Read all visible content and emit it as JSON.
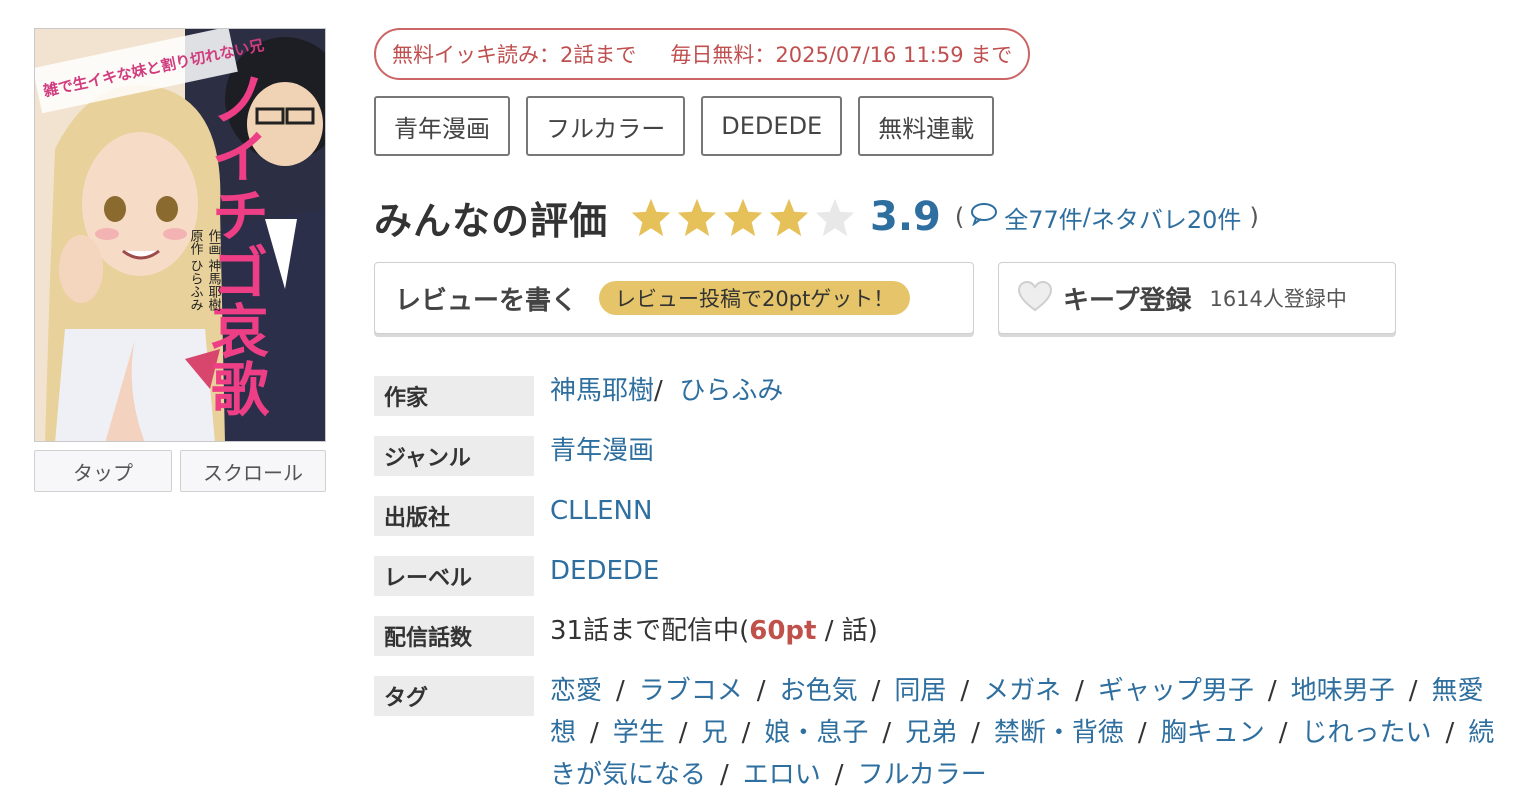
{
  "cover": {
    "title_main": "ノイチゴ哀歌",
    "tagline": "雑で生イキな妹と割り切れない兄",
    "credits": [
      "原作 ひらふみ",
      "作画 神馬耶樹"
    ]
  },
  "view_buttons": {
    "tap": "タップ",
    "scroll": "スクロール"
  },
  "free_badge": {
    "ikki": "無料イッキ読み：2話まで",
    "daily": "毎日無料：2025/07/16 11:59 まで"
  },
  "top_tags": [
    "青年漫画",
    "フルカラー",
    "DEDEDE",
    "無料連載"
  ],
  "rating": {
    "title": "みんなの評価",
    "score": "3.9",
    "stars_filled": 4,
    "stars_total": 5,
    "paren_open": "(",
    "paren_close": ")",
    "reviews_link": "全77件",
    "slash": "/",
    "spoiler_link": "ネタバレ20件",
    "star_color": "#e6c15a",
    "star_empty_color": "#e8e8e8"
  },
  "review_button": {
    "label": "レビューを書く",
    "bonus": "レビュー投稿で20ptゲット！"
  },
  "keep_button": {
    "label": "キープ登録",
    "count": "1614人登録中"
  },
  "info": {
    "author_label": "作家",
    "authors": [
      "神馬耶樹",
      "ひらふみ"
    ],
    "author_sep": "/",
    "genre_label": "ジャンル",
    "genre": "青年漫画",
    "publisher_label": "出版社",
    "publisher": "CLLENN",
    "label_label": "レーベル",
    "label": "DEDEDE",
    "episodes_label": "配信話数",
    "episodes_prefix": "31話まで配信中(",
    "episodes_pt": "60pt",
    "episodes_suffix": " / 話)",
    "tags_label": "タグ",
    "tags": [
      "恋愛",
      "ラブコメ",
      "お色気",
      "同居",
      "メガネ",
      "ギャップ男子",
      "地味男子",
      "無愛想",
      "学生",
      "兄",
      "娘・息子",
      "兄弟",
      "禁断・背徳",
      "胸キュン",
      "じれったい",
      "続きが気になる",
      "エロい",
      "フルカラー"
    ],
    "tag_sep": "/"
  },
  "colors": {
    "link": "#2f6f9f",
    "badge": "#c05050",
    "bonus_bg": "#e6c56a",
    "point": "#c0504a"
  }
}
